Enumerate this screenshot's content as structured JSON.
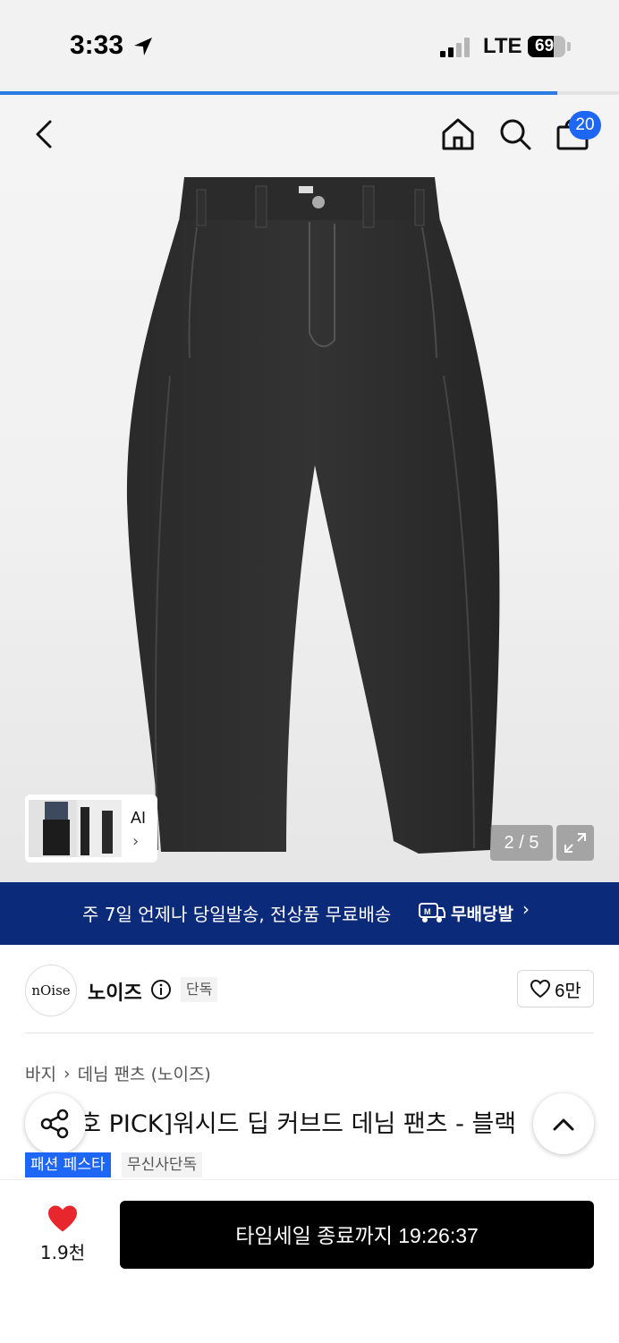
{
  "status_bar": {
    "time": "3:33",
    "network": "LTE",
    "battery": "69",
    "battery_level": 0.69
  },
  "page_progress": 0.9,
  "header": {
    "cart_count": "20"
  },
  "gallery": {
    "ai_label": "AI",
    "ai_chevron": "›",
    "counter": "2 / 5"
  },
  "banner": {
    "text": "주 7일 언제나 당일발송, 전상품 무료배송",
    "brand": "무배당발",
    "chevron": "›"
  },
  "brand": {
    "logo_text": "nOise",
    "name": "노이즈",
    "exclusive_tag": "단독",
    "likes": "6만"
  },
  "breadcrumb": {
    "category": "바지",
    "separator": "›",
    "subcategory": "데님 팬츠 (노이즈)"
  },
  "product": {
    "title": "[유아호 PICK]워시드 딥 커브드 데님 팬츠 - 블랙",
    "tags": [
      "패션 페스타",
      "무신사단독"
    ]
  },
  "bottom_bar": {
    "heart_count": "1.9천",
    "buy_label": "타임세일 종료까지 19:26:37"
  },
  "colors": {
    "accent_blue": "#1e66f5",
    "banner_navy": "#0c2a7a",
    "heart_red": "#e8262d"
  }
}
